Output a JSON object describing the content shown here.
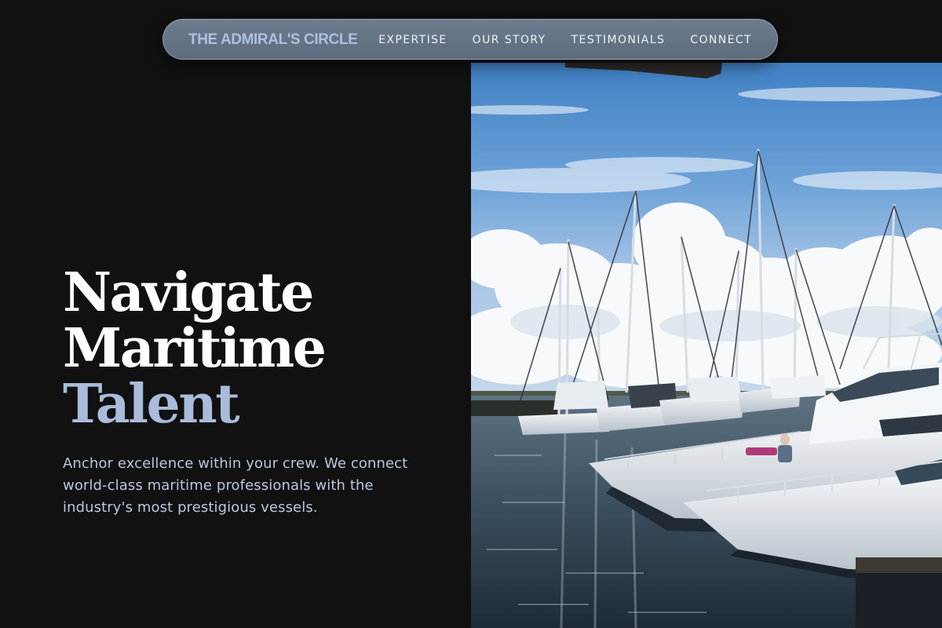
{
  "nav": {
    "brand": "THE ADMIRAL'S CIRCLE",
    "links": [
      {
        "label": "EXPERTISE"
      },
      {
        "label": "OUR STORY"
      },
      {
        "label": "TESTIMONIALS"
      },
      {
        "label": "CONNECT"
      }
    ]
  },
  "hero": {
    "title_line1": "Navigate",
    "title_line2": "Maritime",
    "title_line3": "Talent",
    "subtitle": "Anchor excellence within your crew. We connect world-class maritime professionals with the industry's most prestigious vessels."
  },
  "photo": {
    "icon": "marina-yachts-photo"
  },
  "colors": {
    "background": "#111112",
    "nav_pill": "#66758a",
    "brand": "#aec0de",
    "accent": "#a9bcd9",
    "subtitle": "#b9c8de",
    "title": "#ffffff"
  }
}
